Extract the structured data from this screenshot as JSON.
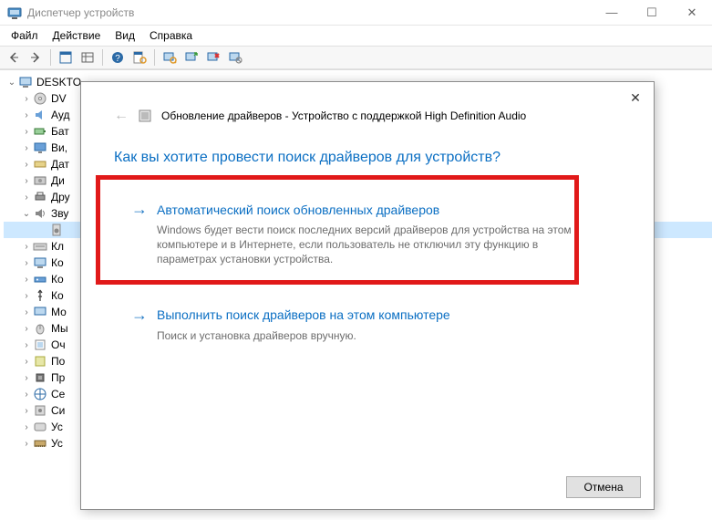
{
  "titlebar": {
    "title": "Диспетчер устройств"
  },
  "winbuttons": {
    "min": "—",
    "max": "☐",
    "close": "✕"
  },
  "menubar": {
    "file": "Файл",
    "action": "Действие",
    "view": "Вид",
    "help": "Справка"
  },
  "tree": {
    "root": "DESKTO",
    "items": [
      {
        "label": "DV",
        "icon": "dvd"
      },
      {
        "label": "Ауд",
        "icon": "audio"
      },
      {
        "label": "Бат",
        "icon": "battery"
      },
      {
        "label": "Ви,",
        "icon": "display"
      },
      {
        "label": "Дат",
        "icon": "sensor"
      },
      {
        "label": "Ди",
        "icon": "disk"
      },
      {
        "label": "Дру",
        "icon": "print"
      },
      {
        "label": "Зву",
        "icon": "sound",
        "expanded": true
      },
      {
        "label": "",
        "icon": "speaker",
        "child": true,
        "selected": true
      },
      {
        "label": "Кл",
        "icon": "keyboard"
      },
      {
        "label": "Ко",
        "icon": "computer"
      },
      {
        "label": "Ко",
        "icon": "network"
      },
      {
        "label": "Ко",
        "icon": "usb"
      },
      {
        "label": "Мо",
        "icon": "monitor"
      },
      {
        "label": "Мы",
        "icon": "mouse"
      },
      {
        "label": "Оч",
        "icon": "queue"
      },
      {
        "label": "По",
        "icon": "sw"
      },
      {
        "label": "Пр",
        "icon": "cpu"
      },
      {
        "label": "Се",
        "icon": "net2"
      },
      {
        "label": "Си",
        "icon": "sys"
      },
      {
        "label": "Ус",
        "icon": "hid"
      },
      {
        "label": "Ус",
        "icon": "mem"
      }
    ]
  },
  "dialog": {
    "header_prefix": "Обновление драйверов - Устройство с поддержкой High Definition Audio",
    "question": "Как вы хотите провести поиск драйверов для устройств?",
    "opt1_title": "Автоматический поиск обновленных драйверов",
    "opt1_desc": "Windows будет вести поиск последних версий драйверов для устройства на этом компьютере и в Интернете, если пользователь не отключил эту функцию в параметрах установки устройства.",
    "opt2_title": "Выполнить поиск драйверов на этом компьютере",
    "opt2_desc": "Поиск и установка драйверов вручную.",
    "cancel": "Отмена",
    "close": "✕",
    "back": "←",
    "arrow": "→"
  }
}
